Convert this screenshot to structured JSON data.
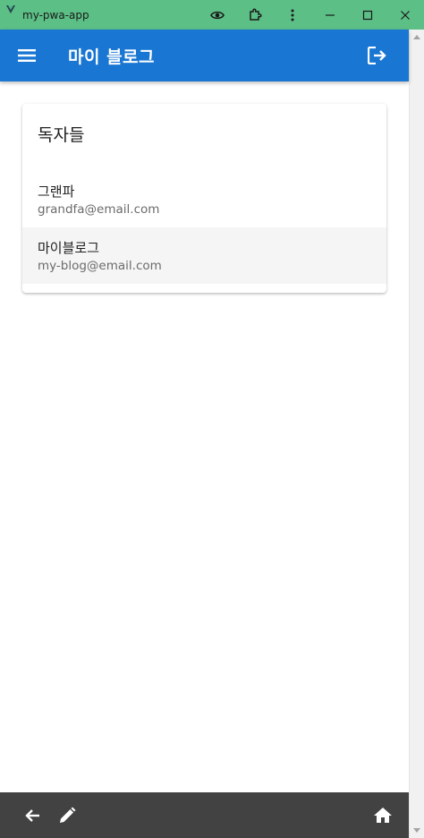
{
  "window": {
    "title": "my-pwa-app",
    "colors": {
      "titlebar": "#5cbf86"
    }
  },
  "appbar": {
    "title": "마이 블로그",
    "menu_icon": "menu-icon",
    "logout_icon": "logout-icon",
    "color": "#1976d2"
  },
  "readers_card": {
    "title": "독자들",
    "items": [
      {
        "name": "그랜파",
        "email": "grandfa@email.com"
      },
      {
        "name": "마이블로그",
        "email": "my-blog@email.com"
      }
    ]
  },
  "bottombar": {
    "color": "#424242",
    "icons": [
      "arrow-back-icon",
      "pencil-icon",
      "home-icon"
    ]
  }
}
